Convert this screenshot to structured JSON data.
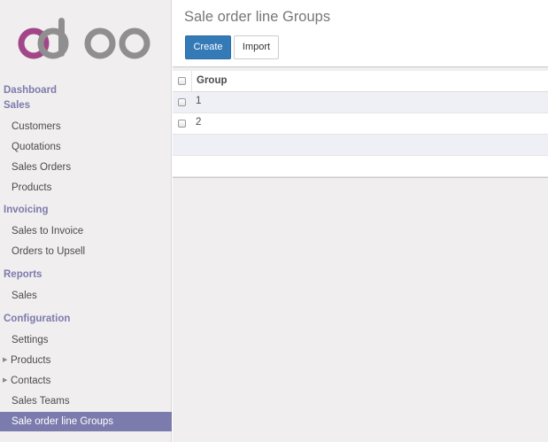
{
  "app": {
    "logo_text": "odoo"
  },
  "sidebar": {
    "sections": {
      "dashboard": "Dashboard",
      "sales": "Sales",
      "invoicing": "Invoicing",
      "reports": "Reports",
      "configuration": "Configuration"
    },
    "items": {
      "customers": "Customers",
      "quotations": "Quotations",
      "sales_orders": "Sales Orders",
      "products": "Products",
      "sales_to_invoice": "Sales to Invoice",
      "orders_to_upsell": "Orders to Upsell",
      "reports_sales": "Sales",
      "settings": "Settings",
      "config_products": "Products",
      "contacts": "Contacts",
      "sales_teams": "Sales Teams",
      "sale_order_line_groups": "Sale order line Groups"
    },
    "colors": {
      "section": "#7c7bad",
      "active_bg": "#7c7bad",
      "logo_purple": "#a24689",
      "logo_grey": "#8f8f8f"
    }
  },
  "control_panel": {
    "breadcrumb": "Sale order line Groups",
    "create_label": "Create",
    "import_label": "Import",
    "colors": {
      "primary": "#337ab7"
    }
  },
  "list": {
    "header": {
      "group": "Group"
    },
    "rows": [
      {
        "group": "1"
      },
      {
        "group": "2"
      }
    ]
  }
}
